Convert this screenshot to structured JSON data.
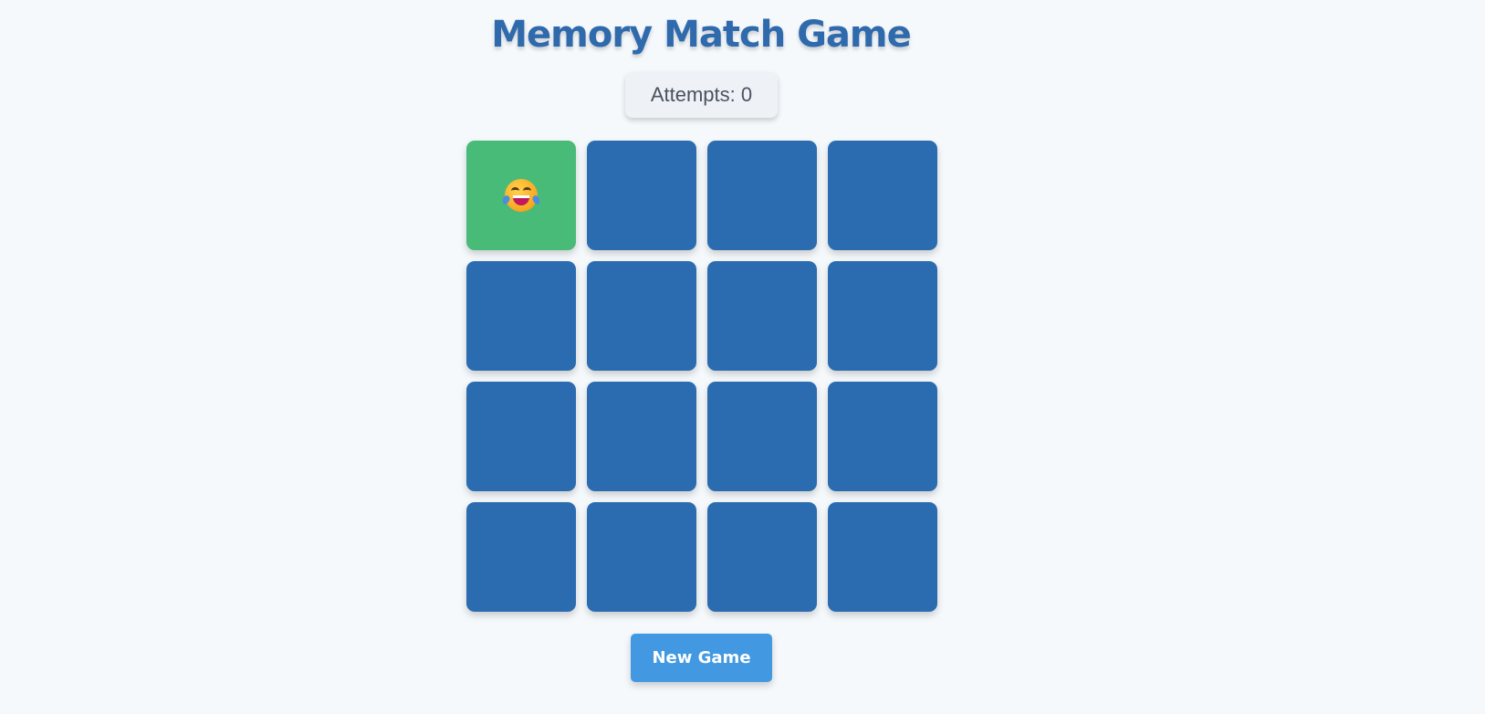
{
  "title": "Memory Match Game",
  "attempts": {
    "label": "Attempts:",
    "value": "0"
  },
  "board": {
    "cards": [
      {
        "state": "flipped",
        "icon": "face-with-tears-of-joy-icon"
      },
      {
        "state": "hidden"
      },
      {
        "state": "hidden"
      },
      {
        "state": "hidden"
      },
      {
        "state": "hidden"
      },
      {
        "state": "hidden"
      },
      {
        "state": "hidden"
      },
      {
        "state": "hidden"
      },
      {
        "state": "hidden"
      },
      {
        "state": "hidden"
      },
      {
        "state": "hidden"
      },
      {
        "state": "hidden"
      },
      {
        "state": "hidden"
      },
      {
        "state": "hidden"
      },
      {
        "state": "hidden"
      },
      {
        "state": "hidden"
      }
    ]
  },
  "new_game_label": "New Game",
  "colors": {
    "background": "#f5f9fc",
    "title": "#2f6aad",
    "card_back": "#2b6cb0",
    "card_flipped": "#48bb78",
    "button": "#4299e1"
  }
}
